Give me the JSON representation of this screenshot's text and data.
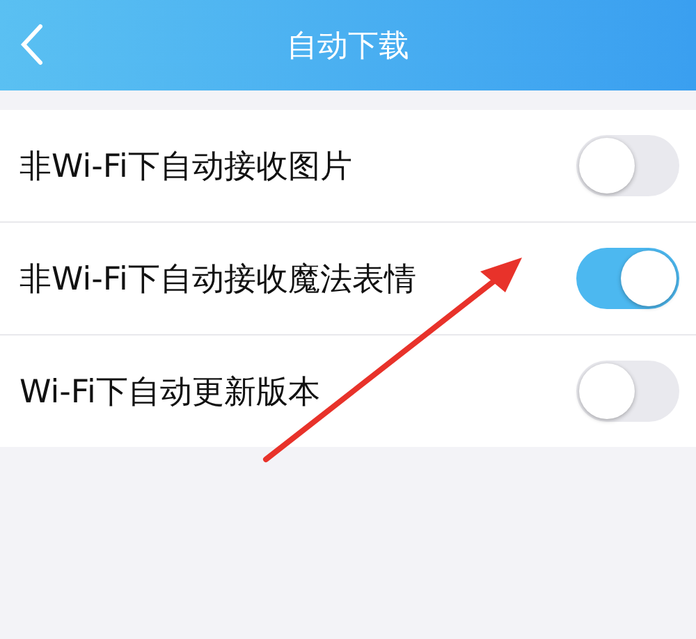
{
  "header": {
    "title": "自动下载"
  },
  "settings": [
    {
      "label": "非Wi-Fi下自动接收图片",
      "on": false
    },
    {
      "label": "非Wi-Fi下自动接收魔法表情",
      "on": true
    },
    {
      "label": "Wi-Fi下自动更新版本",
      "on": false
    }
  ]
}
